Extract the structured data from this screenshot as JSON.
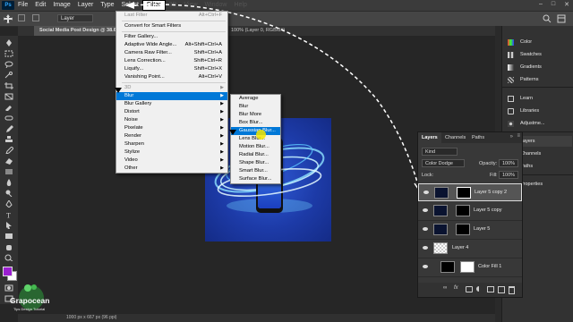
{
  "menubar": {
    "logo": "Ps",
    "items": [
      "File",
      "Edit",
      "Image",
      "Layer",
      "Type",
      "Select",
      "Filter",
      "3D",
      "View",
      "Window",
      "Help"
    ],
    "active": "Filter"
  },
  "options_bar": {
    "layer_dropdown": "Layer"
  },
  "document": {
    "tab_title": "Social Media Post Design @ 38.6",
    "tab_info": "100% (Layer 0, RGB/8#)",
    "status": "1000 px x 667 px (96 ppi)"
  },
  "filter_menu": {
    "items": [
      {
        "label": "Last Filter",
        "shortcut": "Alt+Ctrl+F",
        "disabled": true
      },
      {
        "sep": true
      },
      {
        "label": "Convert for Smart Filters"
      },
      {
        "sep": true
      },
      {
        "label": "Filter Gallery..."
      },
      {
        "label": "Adaptive Wide Angle...",
        "shortcut": "Alt+Shift+Ctrl+A"
      },
      {
        "label": "Camera Raw Filter...",
        "shortcut": "Shift+Ctrl+A"
      },
      {
        "label": "Lens Correction...",
        "shortcut": "Shift+Ctrl+R"
      },
      {
        "label": "Liquify...",
        "shortcut": "Shift+Ctrl+X"
      },
      {
        "label": "Vanishing Point...",
        "shortcut": "Alt+Ctrl+V"
      },
      {
        "sep": true
      },
      {
        "label": "3D",
        "submenu": true,
        "disabled": true
      },
      {
        "label": "Blur",
        "submenu": true,
        "highlighted": true
      },
      {
        "label": "Blur Gallery",
        "submenu": true
      },
      {
        "label": "Distort",
        "submenu": true
      },
      {
        "label": "Noise",
        "submenu": true
      },
      {
        "label": "Pixelate",
        "submenu": true
      },
      {
        "label": "Render",
        "submenu": true
      },
      {
        "label": "Sharpen",
        "submenu": true
      },
      {
        "label": "Stylize",
        "submenu": true
      },
      {
        "label": "Video",
        "submenu": true
      },
      {
        "label": "Other",
        "submenu": true
      }
    ]
  },
  "blur_submenu": {
    "items": [
      {
        "label": "Average"
      },
      {
        "label": "Blur"
      },
      {
        "label": "Blur More"
      },
      {
        "label": "Box Blur..."
      },
      {
        "label": "Gaussian Blur...",
        "highlighted": true
      },
      {
        "label": "Lens Blur..."
      },
      {
        "label": "Motion Blur..."
      },
      {
        "label": "Radial Blur..."
      },
      {
        "label": "Shape Blur..."
      },
      {
        "label": "Smart Blur..."
      },
      {
        "label": "Surface Blur..."
      }
    ]
  },
  "layers_panel": {
    "tabs": [
      "Layers",
      "Channels",
      "Paths"
    ],
    "active_tab": "Layers",
    "filter_label": "Kind",
    "blend_mode": "Color Dodge",
    "opacity_label": "Opacity:",
    "opacity_value": "100%",
    "lock_label": "Lock:",
    "fill_label": "Fill:",
    "fill_value": "100%",
    "layers": [
      {
        "name": "Layer 5 copy 2",
        "selected": true,
        "type": "masked"
      },
      {
        "name": "Layer 5 copy",
        "type": "masked"
      },
      {
        "name": "Layer 5",
        "type": "masked"
      },
      {
        "name": "Layer 4",
        "type": "plain"
      },
      {
        "name": "Color Fill 1",
        "type": "fill"
      }
    ]
  },
  "right_panels": {
    "group1": [
      "Color",
      "Swatches",
      "Gradients",
      "Patterns"
    ],
    "group2": [
      "Learn",
      "Libraries",
      "Adjustme..."
    ],
    "group3": [
      "Layers",
      "Channels",
      "Paths"
    ],
    "group4": [
      "Properties"
    ]
  },
  "artwork": {
    "phone_time": "45"
  },
  "logo": {
    "name": "Grapocean",
    "tagline": "Tips Design Tutorial"
  },
  "colors": {
    "accent": "#0078d7",
    "foreground_swatch": "#9b1fd1",
    "canvas_blue": "#1d3ba8"
  }
}
